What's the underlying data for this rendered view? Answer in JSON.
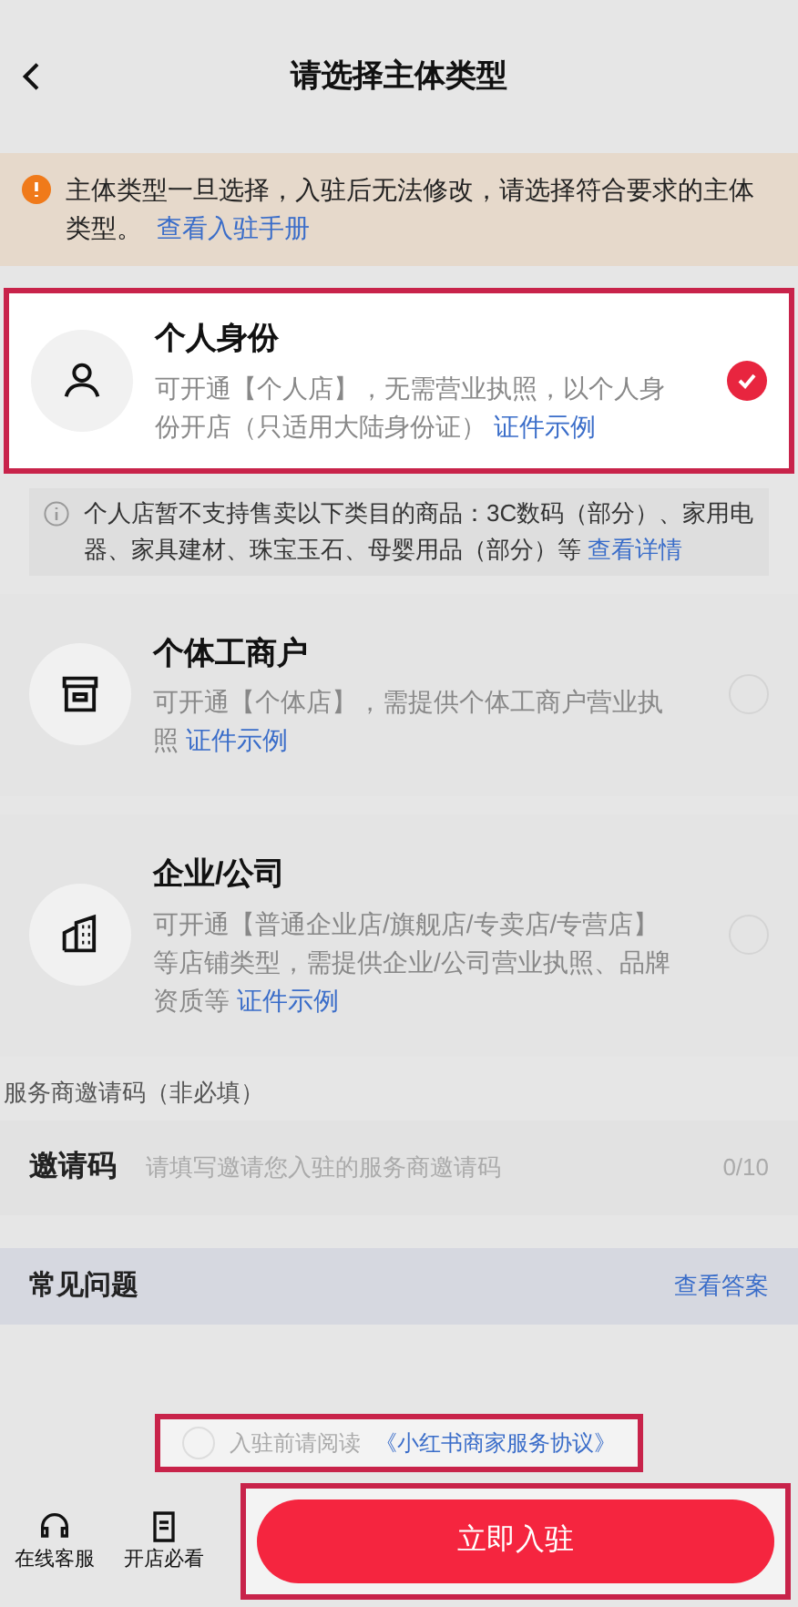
{
  "header": {
    "title": "请选择主体类型"
  },
  "notice": {
    "text": "主体类型一旦选择，入驻后无法修改，请选择符合要求的主体类型。",
    "link": "查看入驻手册"
  },
  "options": [
    {
      "kind": "person",
      "title": "个人身份",
      "desc": "可开通【个人店】，无需营业执照，以个人身份开店（只适用大陆身份证）",
      "link": "证件示例",
      "selected": true,
      "note": {
        "text": "个人店暂不支持售卖以下类目的商品：3C数码（部分）、家用电器、家具建材、珠宝玉石、母婴用品（部分）等",
        "link": "查看详情"
      }
    },
    {
      "kind": "store",
      "title": "个体工商户",
      "desc": "可开通【个体店】，需提供个体工商户营业执照",
      "link": "证件示例",
      "selected": false
    },
    {
      "kind": "building",
      "title": "企业/公司",
      "desc": "可开通【普通企业店/旗舰店/专卖店/专营店】等店铺类型，需提供企业/公司营业执照、品牌资质等",
      "link": "证件示例",
      "selected": false
    }
  ],
  "invite": {
    "section_label": "服务商邀请码（非必填）",
    "label": "邀请码",
    "placeholder": "请填写邀请您入驻的服务商邀请码",
    "counter": "0/10"
  },
  "faq": {
    "title": "常见问题",
    "link": "查看答案"
  },
  "agreement": {
    "checked": false,
    "text": "入驻前请阅读",
    "link": "《小红书商家服务协议》"
  },
  "bottom": {
    "tools": [
      {
        "kind": "headset",
        "label": "在线客服"
      },
      {
        "kind": "doc",
        "label": "开店必看"
      }
    ],
    "button": "立即入驻"
  }
}
